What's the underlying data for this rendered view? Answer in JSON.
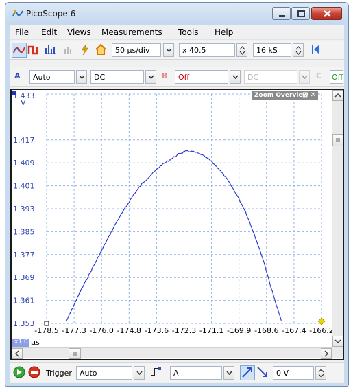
{
  "window": {
    "title": "PicoScope 6"
  },
  "menu": {
    "items": [
      "File",
      "Edit",
      "Views",
      "Measurements",
      "Tools",
      "Help"
    ]
  },
  "toolbar1": {
    "timebase": "50 µs/div",
    "zoom": "x 40.5",
    "samples": "16 kS"
  },
  "toolbar2": {
    "channel_a_label": "A",
    "channel_a_range": "Auto",
    "channel_a_coupling": "DC",
    "channel_b_label": "B",
    "channel_b_range": "Off",
    "channel_b_coupling": "DC",
    "channel_c_label": "C",
    "channel_c_range": "Off"
  },
  "scope": {
    "y_unit": "V",
    "x_unit": "µs",
    "x_zoom_badge": "x1.0",
    "zoom_overview_title": "Zoom Overview",
    "zoom_overview_controls": "⊡ ✕"
  },
  "bottom": {
    "trigger_label": "Trigger",
    "trigger_mode": "Auto",
    "trigger_source": "A",
    "trigger_level": "0 V"
  },
  "colors": {
    "trace": "#1f2fc8",
    "grid": "#8fb4e8",
    "axis_text": "#2a3fb0"
  },
  "chart_data": {
    "type": "line",
    "y_ticks": [
      "1.433",
      "1.417",
      "1.409",
      "1.401",
      "1.393",
      "1.385",
      "1.377",
      "1.369",
      "1.361",
      "1.353"
    ],
    "x_ticks": [
      "-178.5",
      "-177.3",
      "-176.0",
      "-174.8",
      "-173.6",
      "-172.3",
      "-171.1",
      "-169.9",
      "-168.6",
      "-167.4",
      "-166.2"
    ],
    "ylim": [
      1.353,
      1.433
    ],
    "xlim": [
      -178.5,
      -166.2
    ],
    "grid": true,
    "series": [
      {
        "x": [
          -177.6,
          -177.3,
          -177.0,
          -176.6,
          -176.2,
          -175.8,
          -175.4,
          -175.0,
          -174.6,
          -174.2,
          -173.8,
          -173.4,
          -173.0,
          -172.6,
          -172.3,
          -172.0,
          -171.6,
          -171.2,
          -170.8,
          -170.4,
          -170.0,
          -169.6,
          -169.2,
          -168.8,
          -168.4,
          -168.0
        ],
        "y": [
          1.354,
          1.359,
          1.364,
          1.37,
          1.376,
          1.382,
          1.388,
          1.393,
          1.398,
          1.402,
          1.405,
          1.408,
          1.41,
          1.412,
          1.413,
          1.413,
          1.412,
          1.41,
          1.407,
          1.403,
          1.398,
          1.392,
          1.384,
          1.375,
          1.364,
          1.354
        ]
      }
    ]
  }
}
